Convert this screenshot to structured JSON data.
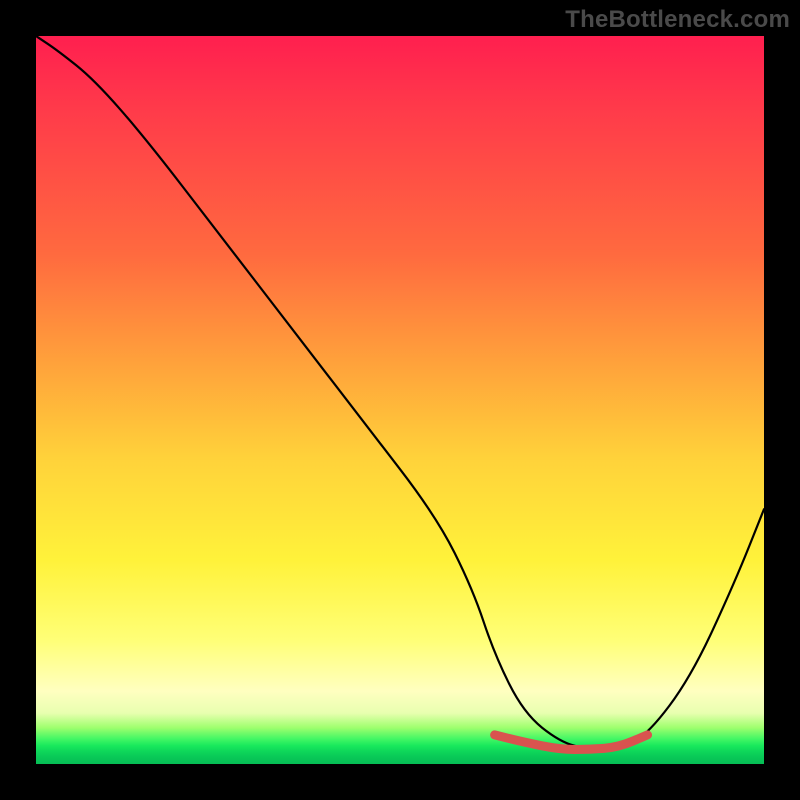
{
  "watermark": "TheBottleneck.com",
  "chart_data": {
    "type": "line",
    "title": "",
    "xlabel": "",
    "ylabel": "",
    "xlim": [
      0,
      100
    ],
    "ylim": [
      0,
      100
    ],
    "grid": false,
    "legend": false,
    "background_gradient": {
      "direction": "vertical",
      "stops": [
        {
          "pos": 0.0,
          "color": "#ff1f4f"
        },
        {
          "pos": 0.3,
          "color": "#ff6a3f"
        },
        {
          "pos": 0.58,
          "color": "#ffd23a"
        },
        {
          "pos": 0.83,
          "color": "#ffff77"
        },
        {
          "pos": 0.95,
          "color": "#9fff6e"
        },
        {
          "pos": 1.0,
          "color": "#06bd55"
        }
      ]
    },
    "series": [
      {
        "name": "bottleneck-curve",
        "color": "#000000",
        "x": [
          0,
          3,
          8,
          15,
          25,
          35,
          45,
          55,
          60,
          63,
          67,
          72,
          76,
          80,
          84,
          90,
          96,
          100
        ],
        "y": [
          100,
          98,
          94,
          86,
          73,
          60,
          47,
          34,
          24,
          15,
          7,
          3,
          2,
          2,
          4,
          12,
          25,
          35
        ]
      },
      {
        "name": "optimal-range-highlight",
        "color": "#d9534f",
        "x": [
          63,
          67,
          72,
          76,
          80,
          84
        ],
        "y": [
          4,
          3,
          2,
          2,
          2.3,
          4
        ]
      }
    ],
    "annotations": []
  }
}
